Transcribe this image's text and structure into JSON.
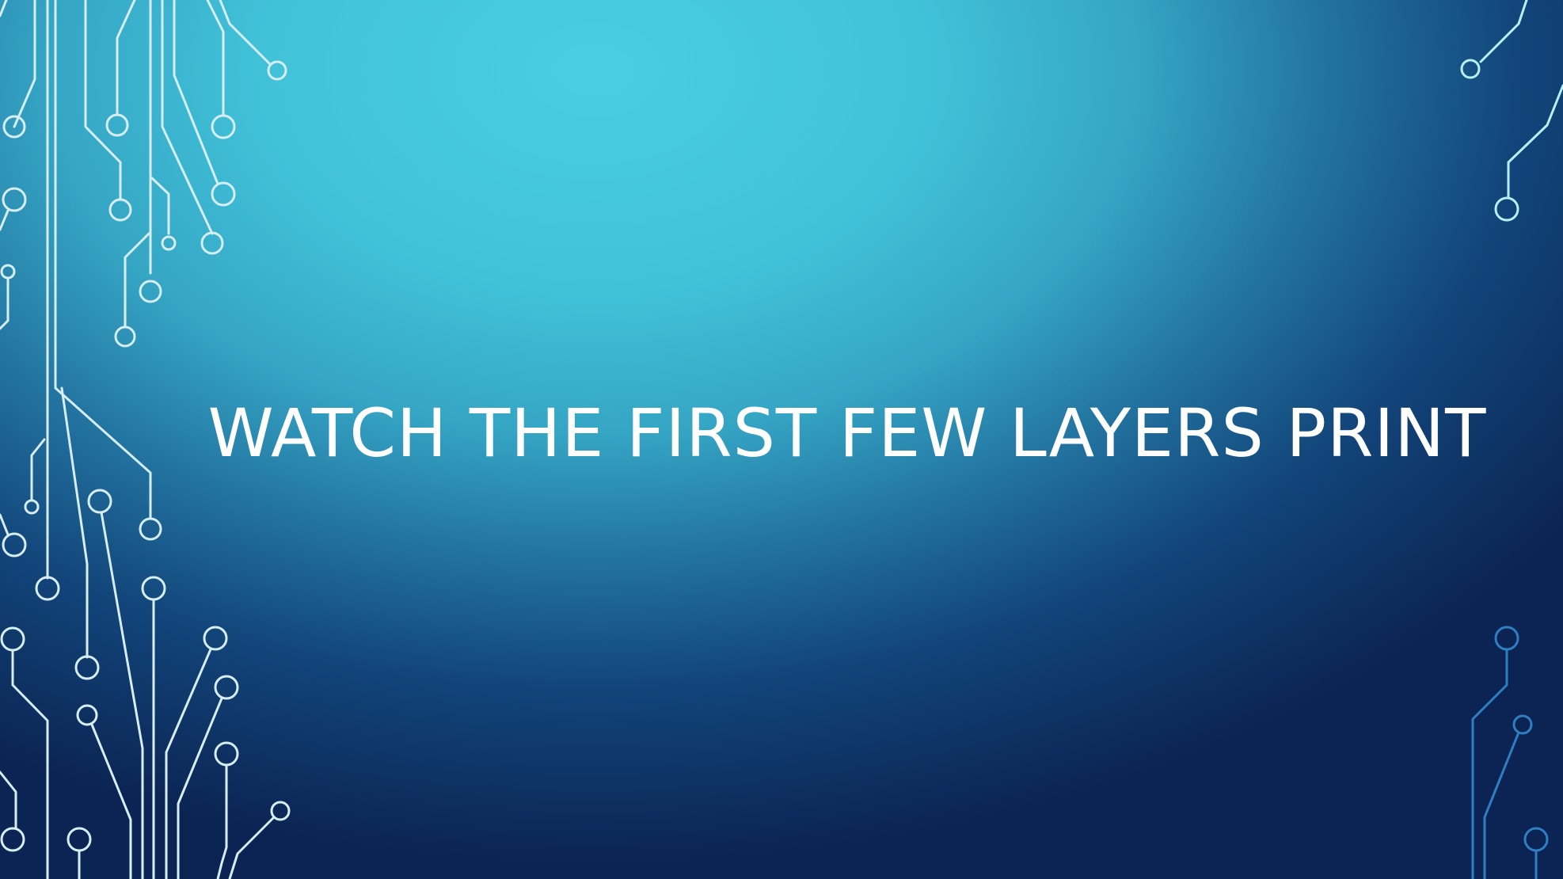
{
  "slide": {
    "title": "WATCH THE FIRST FEW LAYERS PRINT"
  },
  "colors": {
    "background_light": "#49cfe1",
    "background_dark": "#0b2453",
    "circuit_left": "#d6eef2",
    "circuit_right_top": "#b8f0f7",
    "circuit_right_bottom": "#2f7fc0",
    "title_text": "#ffffff"
  },
  "decorations": {
    "left": "circuit-board-lines",
    "right": "circuit-board-lines"
  }
}
